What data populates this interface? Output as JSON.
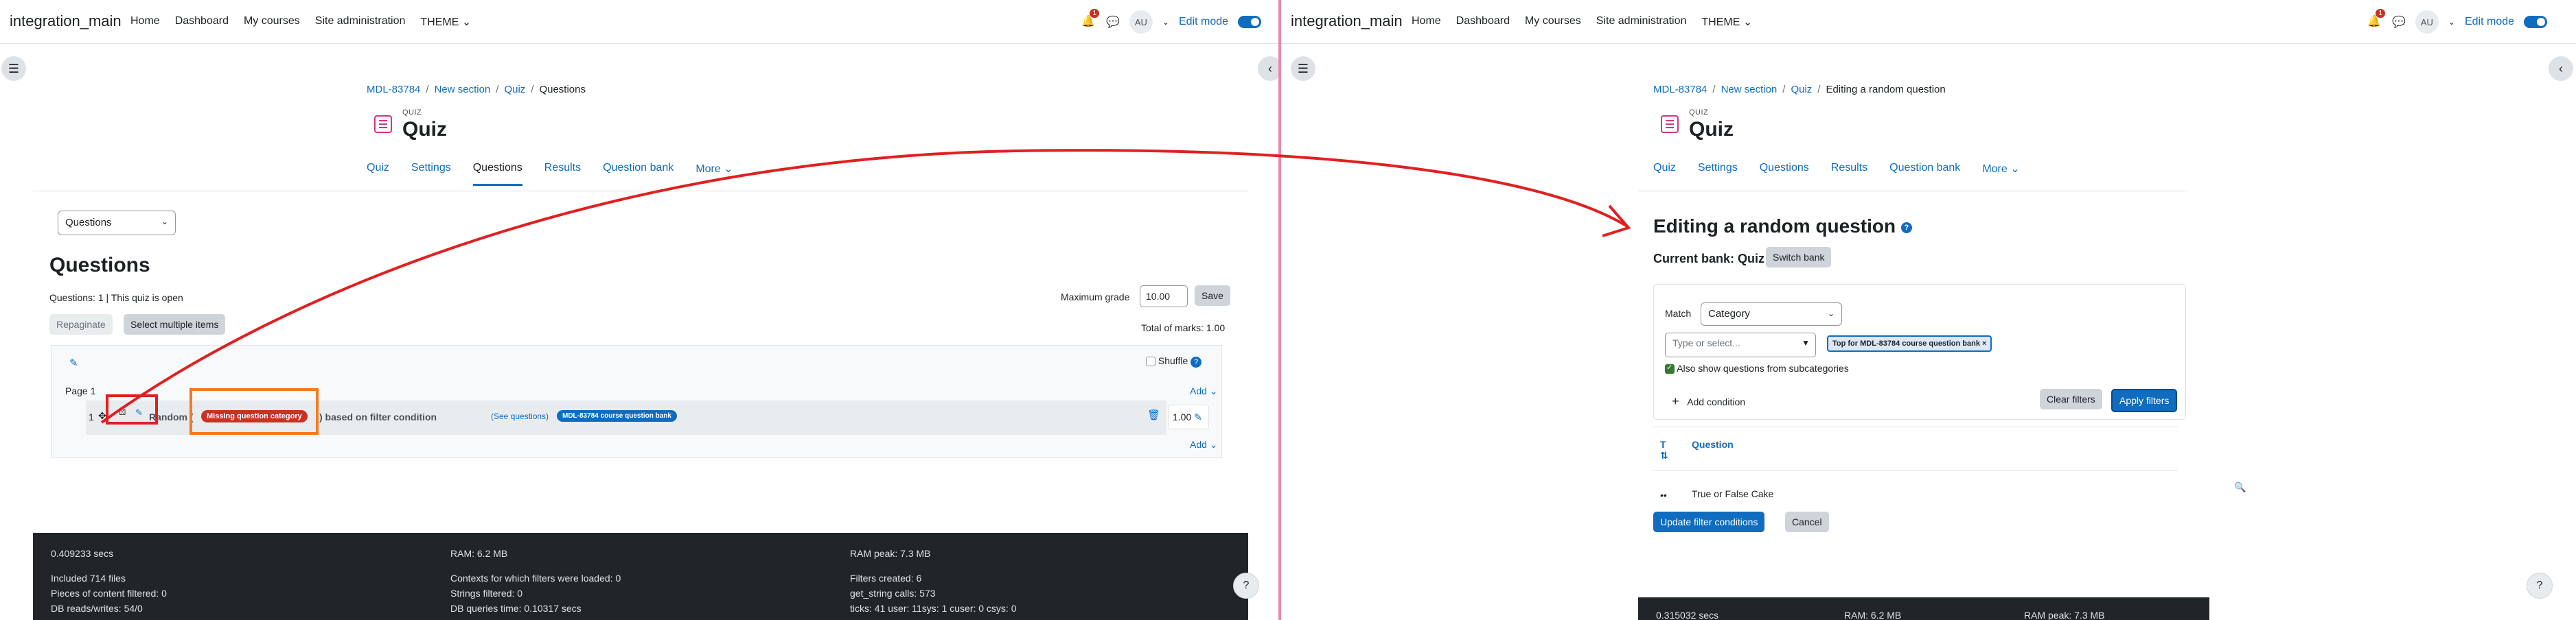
{
  "left": {
    "navbar": {
      "brand": "integration_main",
      "links": [
        "Home",
        "Dashboard",
        "My courses",
        "Site administration",
        "THEME"
      ],
      "notification_count": "1",
      "avatar_initials": "AU",
      "edit_mode_label": "Edit mode"
    },
    "breadcrumb": [
      "MDL-83784",
      "New section",
      "Quiz",
      "Questions"
    ],
    "activity_kicker": "QUIZ",
    "activity_title": "Quiz",
    "tabs": [
      "Quiz",
      "Settings",
      "Questions",
      "Results",
      "Question bank",
      "More"
    ],
    "active_tab": "Questions",
    "view_select": "Questions",
    "heading": "Questions",
    "status_line": "Questions: 1 | This quiz is open",
    "max_grade_label": "Maximum grade",
    "max_grade_value": "10.00",
    "save_label": "Save",
    "repaginate_label": "Repaginate",
    "select_multiple_label": "Select multiple items",
    "total_marks": "Total of marks: 1.00",
    "shuffle_label": "Shuffle",
    "page_label": "Page 1",
    "add_label": "Add",
    "question": {
      "number": "1",
      "text_start": "Random (",
      "missing_badge": "Missing question category",
      "text_end": ") based on filter condition",
      "see_questions": "(See questions)",
      "bank_badge": "MDL-83784 course question bank",
      "mark": "1.00"
    },
    "footer": {
      "col1": [
        "0.409233 secs",
        "Included 714 files",
        "Pieces of content filtered: 0",
        "DB reads/writes: 54/0"
      ],
      "col2": [
        "RAM: 6.2 MB",
        "Contexts for which filters were loaded: 0",
        "Strings filtered: 0",
        "DB queries time: 0.10317 secs"
      ],
      "col3": [
        "RAM peak: 7.3 MB",
        "Filters created: 6",
        "get_string calls: 573",
        "ticks: 41 user: 11sys: 1 cuser: 0 csys: 0"
      ]
    }
  },
  "right": {
    "navbar": {
      "brand": "integration_main",
      "links": [
        "Home",
        "Dashboard",
        "My courses",
        "Site administration",
        "THEME"
      ],
      "notification_count": "1",
      "avatar_initials": "AU",
      "edit_mode_label": "Edit mode"
    },
    "breadcrumb": [
      "MDL-83784",
      "New section",
      "Quiz",
      "Editing a random question"
    ],
    "activity_kicker": "QUIZ",
    "activity_title": "Quiz",
    "tabs": [
      "Quiz",
      "Settings",
      "Questions",
      "Results",
      "Question bank",
      "More"
    ],
    "heading": "Editing a random question",
    "current_bank_label": "Current bank: Quiz",
    "switch_bank_label": "Switch bank",
    "filter": {
      "match_label": "Match",
      "match_value": "Category",
      "type_placeholder": "Type or select...",
      "chip": "Top for MDL-83784 course question bank",
      "subcategories_label": "Also show questions from subcategories",
      "add_condition_label": "Add condition",
      "clear_filters_label": "Clear filters",
      "apply_filters_label": "Apply filters"
    },
    "table": {
      "col_type": "T",
      "col_question": "Question",
      "rows": [
        {
          "question": "True or False Cake"
        }
      ]
    },
    "update_filter_label": "Update filter conditions",
    "cancel_label": "Cancel",
    "footer": {
      "col1": "0.315032 secs",
      "col2": "RAM: 6.2 MB",
      "col3": "RAM peak: 7.3 MB"
    }
  },
  "colors": {
    "primary": "#0f6cbf",
    "danger": "#ca3120",
    "annotation_red": "#e02020",
    "annotation_orange": "#f47a20",
    "footer_bg": "#212529"
  }
}
